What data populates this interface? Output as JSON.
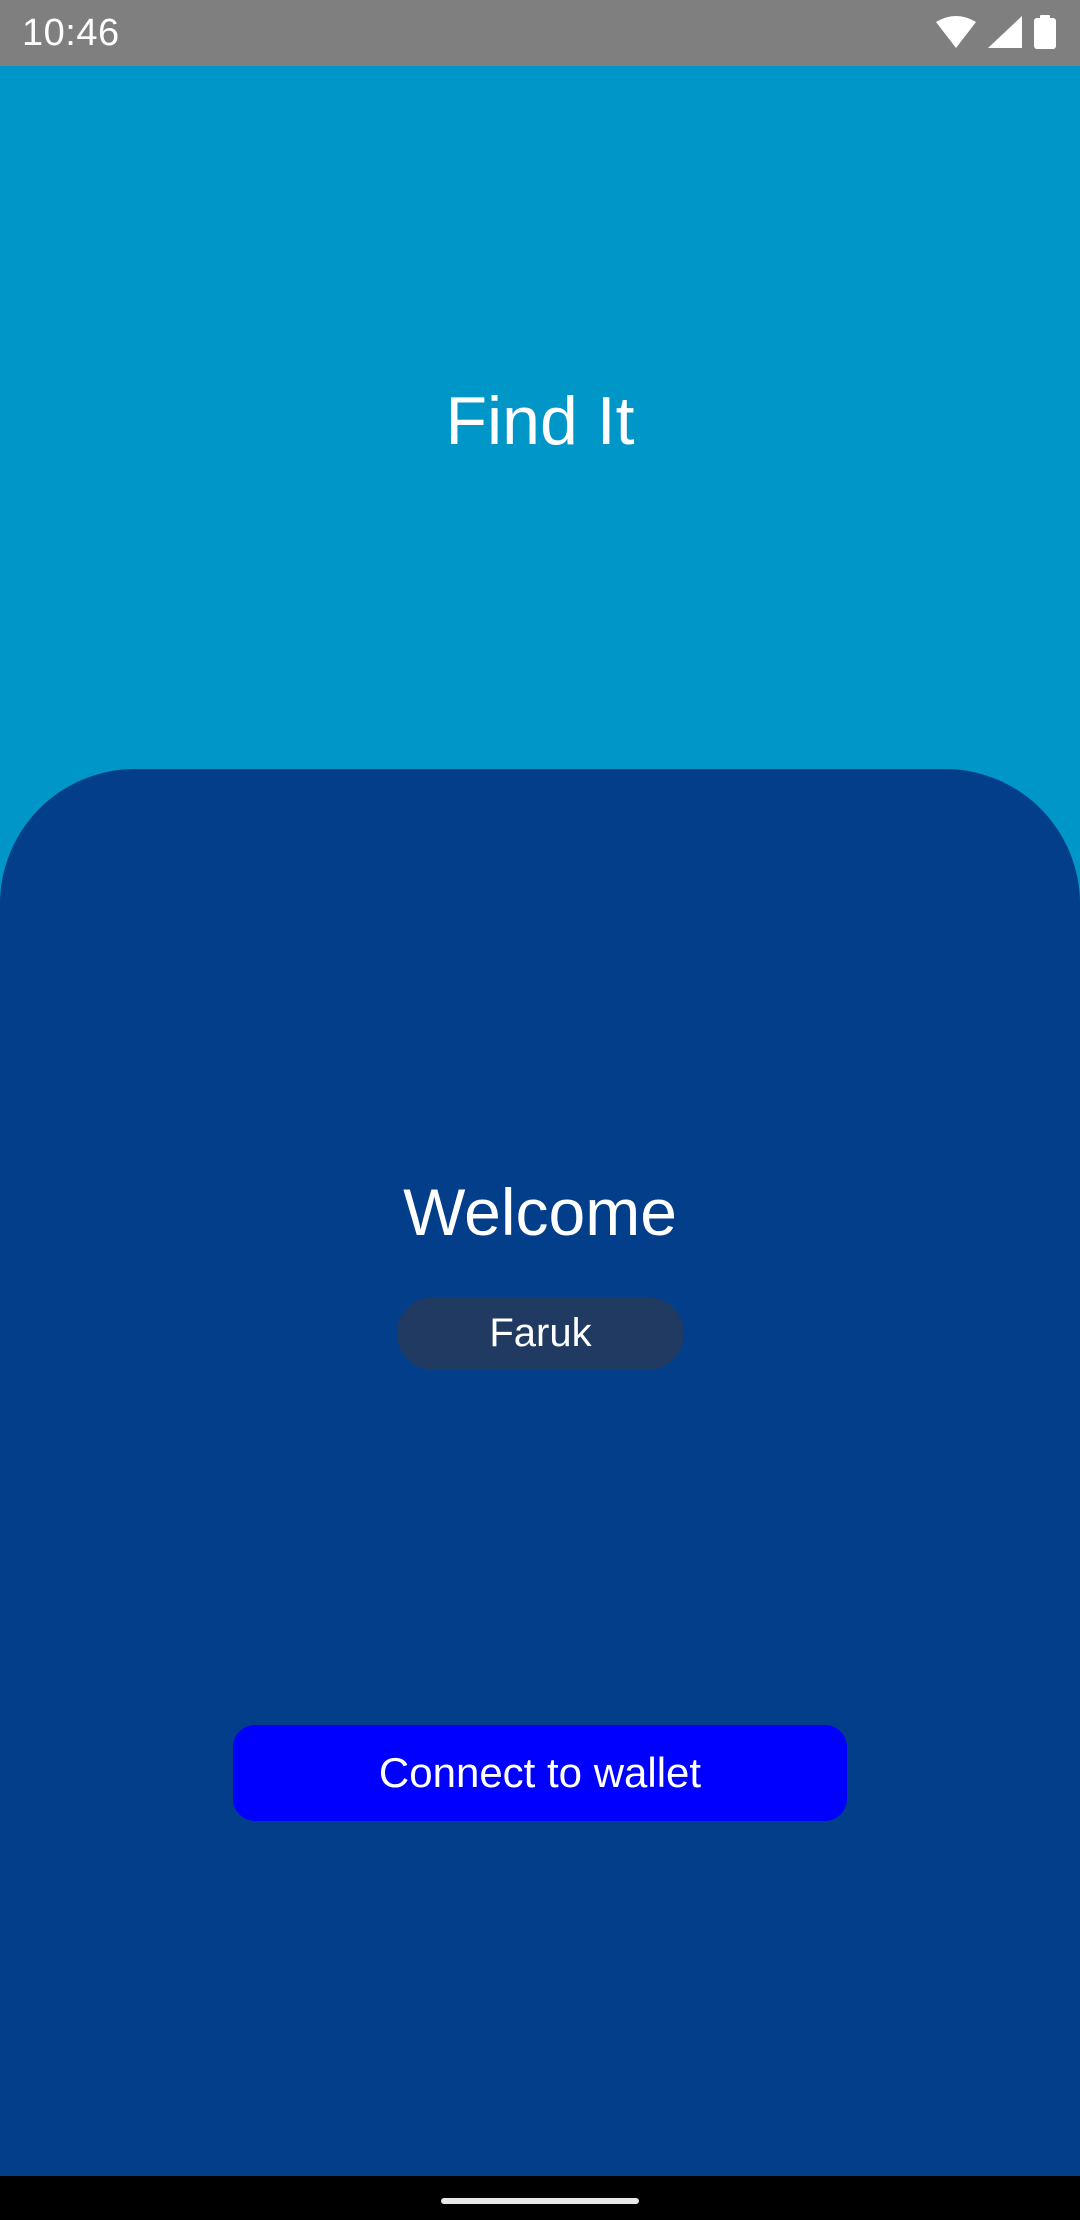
{
  "status_bar": {
    "time": "10:46",
    "icons": [
      "wifi-icon",
      "signal-icon",
      "battery-icon"
    ]
  },
  "header": {
    "title": "Find It"
  },
  "card": {
    "welcome": "Welcome",
    "username": "Faruk",
    "connect_label": "Connect to wallet"
  },
  "colors": {
    "status_bar": "#7f7f7f",
    "header_background": "#0096c7",
    "card_background": "#023e8a",
    "chip_background": "#203a62",
    "button_background": "#0000ff",
    "text": "#ffffff"
  }
}
